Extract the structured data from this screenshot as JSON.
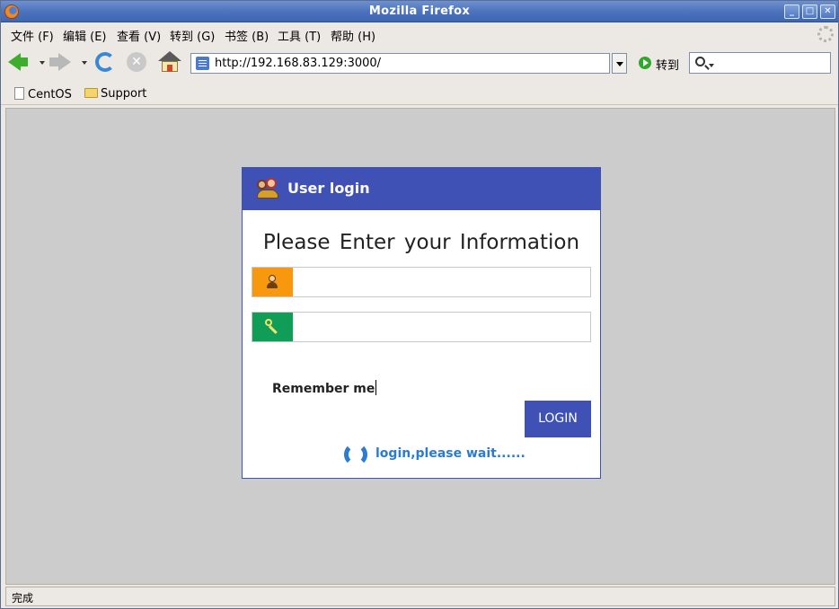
{
  "window": {
    "title": "Mozilla Firefox",
    "controls": {
      "minimize": "_",
      "maximize": "□",
      "close": "✕"
    }
  },
  "menubar": {
    "items": [
      {
        "label": "文件 (F)"
      },
      {
        "label": "编辑 (E)"
      },
      {
        "label": "查看 (V)"
      },
      {
        "label": "转到 (G)"
      },
      {
        "label": "书签 (B)"
      },
      {
        "label": "工具 (T)"
      },
      {
        "label": "帮助 (H)"
      }
    ]
  },
  "navbar": {
    "url": "http://192.168.83.129:3000/",
    "go_label": "转到",
    "search_placeholder": "",
    "stop_glyph": "✕"
  },
  "bookmarks": [
    {
      "label": "CentOS",
      "icon": "document-icon"
    },
    {
      "label": "Support",
      "icon": "folder-icon"
    }
  ],
  "login": {
    "header_title": "User login",
    "heading": "Please Enter your Information",
    "username_value": "",
    "password_value": "",
    "remember_label": "Remember me",
    "login_button": "LOGIN",
    "wait_text": "login,please wait......",
    "colors": {
      "header": "#3f51b5",
      "username_tag": "#f7980f",
      "password_tag": "#0f9d58",
      "wait_text": "#2a7bd1"
    }
  },
  "status": {
    "text": "完成"
  }
}
